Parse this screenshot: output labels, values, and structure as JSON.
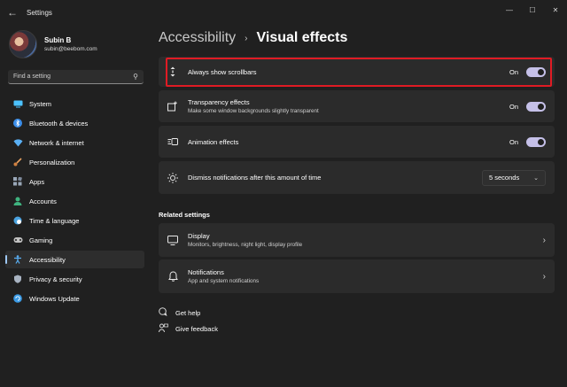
{
  "window": {
    "title": "Settings",
    "controls": [
      "minimize",
      "maximize",
      "close"
    ]
  },
  "profile": {
    "name": "Subin B",
    "email": "subin@beebom.com"
  },
  "search": {
    "placeholder": "Find a setting"
  },
  "sidebar": {
    "items": [
      {
        "label": "System",
        "icon": "monitor-icon",
        "color": "#4cc2ff"
      },
      {
        "label": "Bluetooth & devices",
        "icon": "bluetooth-icon",
        "color": "#3b8eea"
      },
      {
        "label": "Network & internet",
        "icon": "wifi-icon",
        "color": "#5ab0f5"
      },
      {
        "label": "Personalization",
        "icon": "brush-icon",
        "color": "#e8a060"
      },
      {
        "label": "Apps",
        "icon": "apps-icon",
        "color": "#9aa7b8"
      },
      {
        "label": "Accounts",
        "icon": "person-icon",
        "color": "#3fb37f"
      },
      {
        "label": "Time & language",
        "icon": "globe-clock-icon",
        "color": "#4aa3e0"
      },
      {
        "label": "Gaming",
        "icon": "gamepad-icon",
        "color": "#c0c0c0"
      },
      {
        "label": "Accessibility",
        "icon": "accessibility-icon",
        "color": "#5ab0f5",
        "active": true
      },
      {
        "label": "Privacy & security",
        "icon": "shield-icon",
        "color": "#a9b4c2"
      },
      {
        "label": "Windows Update",
        "icon": "update-icon",
        "color": "#3b9be6"
      }
    ]
  },
  "breadcrumb": {
    "parent": "Accessibility",
    "separator": "›",
    "current": "Visual effects"
  },
  "settings": {
    "scrollbars": {
      "title": "Always show scrollbars",
      "state": "On",
      "on": true
    },
    "transparency": {
      "title": "Transparency effects",
      "desc": "Make some window backgrounds slightly transparent",
      "state": "On",
      "on": true
    },
    "animation": {
      "title": "Animation effects",
      "state": "On",
      "on": true
    },
    "dismiss": {
      "title": "Dismiss notifications after this amount of time",
      "value": "5 seconds"
    }
  },
  "related": {
    "heading": "Related settings",
    "display": {
      "title": "Display",
      "desc": "Monitors, brightness, night light, display profile"
    },
    "notifications": {
      "title": "Notifications",
      "desc": "App and system notifications"
    }
  },
  "help": {
    "get_help": "Get help",
    "feedback": "Give feedback"
  },
  "colors": {
    "background": "#202020",
    "card": "#2b2b2b",
    "toggle_on": "#c5c0e8",
    "accent": "#9ec8f5",
    "highlight": "#e01b24"
  }
}
